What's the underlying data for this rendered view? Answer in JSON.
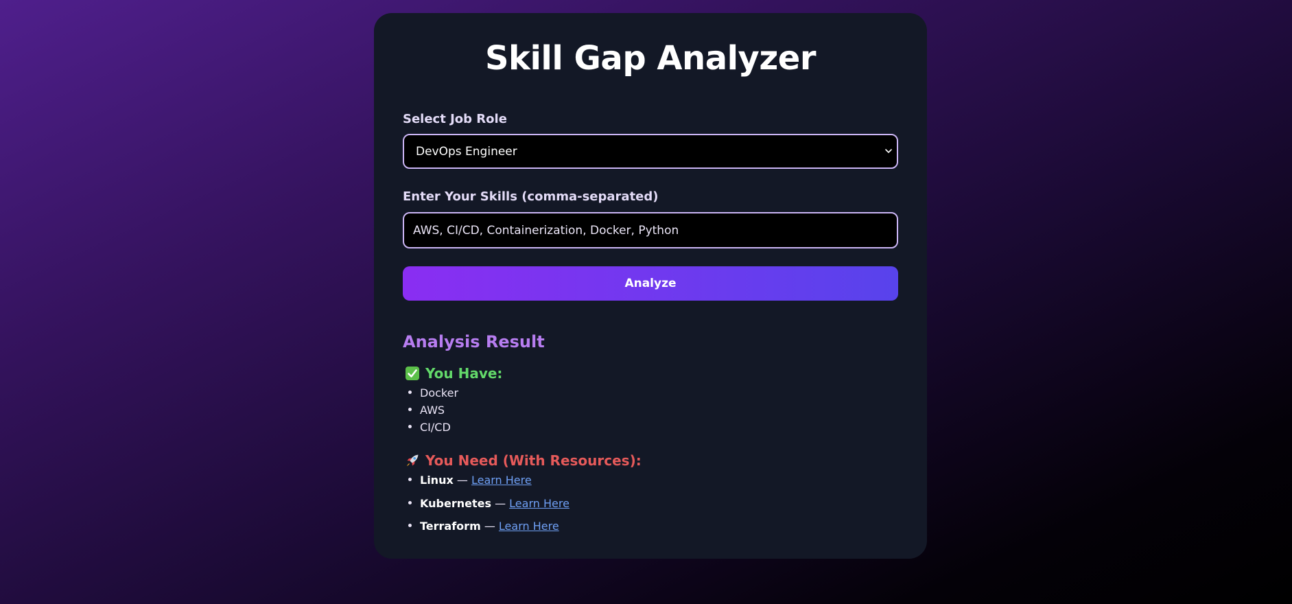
{
  "page": {
    "title": "Skill Gap Analyzer"
  },
  "form": {
    "role_label": "Select Job Role",
    "role_selected": "DevOps Engineer",
    "skills_label": "Enter Your Skills (comma-separated)",
    "skills_value": "AWS, CI/CD, Containerization, Docker, Python",
    "analyze_label": "Analyze"
  },
  "result": {
    "heading": "Analysis Result",
    "have": {
      "heading": "You Have:",
      "icon": "check-mark-icon",
      "items": [
        "Docker",
        "AWS",
        "CI/CD"
      ]
    },
    "need": {
      "heading": "You Need (With Resources):",
      "icon": "rocket-icon",
      "separator": "—",
      "link_label": "Learn Here",
      "items": [
        {
          "skill": "Linux",
          "link": "Learn Here"
        },
        {
          "skill": "Kubernetes",
          "link": "Learn Here"
        },
        {
          "skill": "Terraform",
          "link": "Learn Here"
        }
      ]
    }
  },
  "colors": {
    "accent_start": "#8a2ef2",
    "accent_end": "#5843ec",
    "have": "#63d96a",
    "need": "#e65a5a",
    "result_heading": "#b77df0",
    "link": "#6fa0f5",
    "card": "#131826"
  }
}
